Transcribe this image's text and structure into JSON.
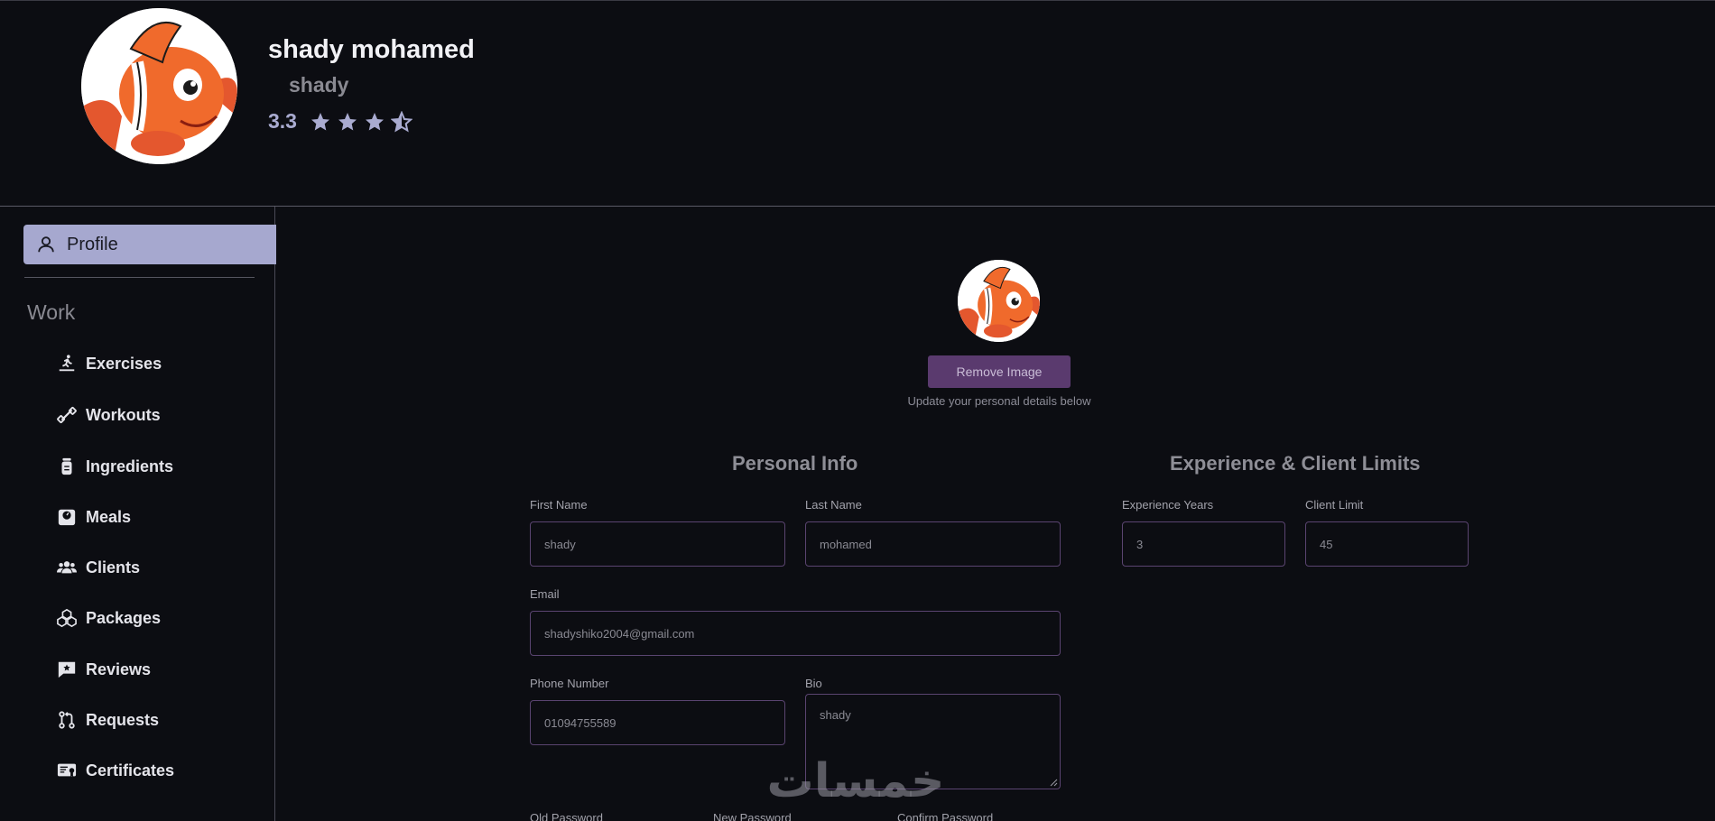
{
  "header": {
    "full_name": "shady mohamed",
    "username": "shady",
    "rating": "3.3",
    "rating_stars": 3.5
  },
  "sidebar": {
    "active_item": {
      "label": "Profile",
      "icon": "user-icon"
    },
    "section_label": "Work",
    "items": [
      {
        "label": "Exercises",
        "icon": "treadmill-icon"
      },
      {
        "label": "Workouts",
        "icon": "dumbbell-icon"
      },
      {
        "label": "Ingredients",
        "icon": "jar-icon"
      },
      {
        "label": "Meals",
        "icon": "scale-icon"
      },
      {
        "label": "Clients",
        "icon": "users-icon"
      },
      {
        "label": "Packages",
        "icon": "cubes-icon"
      },
      {
        "label": "Reviews",
        "icon": "star-message-icon"
      },
      {
        "label": "Requests",
        "icon": "pull-request-icon"
      },
      {
        "label": "Certificates",
        "icon": "certificate-icon"
      }
    ]
  },
  "main": {
    "remove_image_label": "Remove Image",
    "update_hint": "Update your personal details below",
    "personal_info": {
      "title": "Personal Info",
      "first_name": {
        "label": "First Name",
        "value": "shady"
      },
      "last_name": {
        "label": "Last Name",
        "value": "mohamed"
      },
      "email": {
        "label": "Email",
        "value": "shadyshiko2004@gmail.com"
      },
      "phone": {
        "label": "Phone Number",
        "value": "01094755589"
      },
      "bio": {
        "label": "Bio",
        "value": "shady"
      }
    },
    "experience": {
      "title": "Experience & Client Limits",
      "years": {
        "label": "Experience Years",
        "value": "3"
      },
      "client_limit": {
        "label": "Client Limit",
        "value": "45"
      }
    },
    "password": {
      "old_label": "Old Password",
      "new_label": "New Password",
      "confirm_label": "Confirm Password"
    },
    "watermark": "خمسات"
  },
  "colors": {
    "background": "#0c0d12",
    "active_nav": "#a6a8cf",
    "button": "#5a3a6e",
    "field_border": "#5a4470"
  }
}
